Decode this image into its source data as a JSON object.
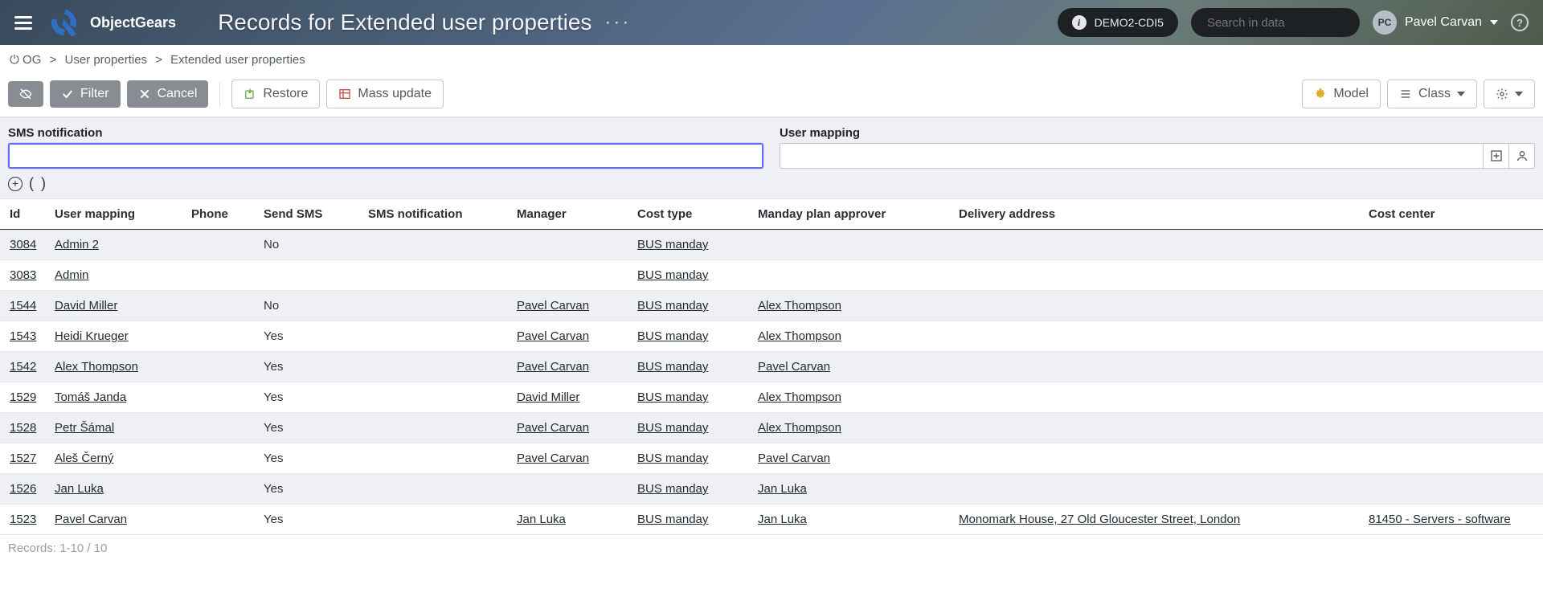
{
  "app": {
    "brand": "ObjectGears",
    "title": "Records for Extended user properties",
    "env_label": "DEMO2-CDI5",
    "search_placeholder": "Search in data",
    "user_initials": "PC",
    "user_name": "Pavel Carvan"
  },
  "breadcrumb": {
    "root": "OG",
    "level1": "User properties",
    "level2": "Extended user properties"
  },
  "toolbar": {
    "filter_label": "Filter",
    "cancel_label": "Cancel",
    "restore_label": "Restore",
    "mass_update_label": "Mass update",
    "model_label": "Model",
    "class_label": "Class"
  },
  "filters": {
    "sms_label": "SMS notification",
    "usermapping_label": "User mapping"
  },
  "columns": {
    "id": "Id",
    "user_mapping": "User mapping",
    "phone": "Phone",
    "send_sms": "Send SMS",
    "sms_notification": "SMS notification",
    "manager": "Manager",
    "cost_type": "Cost type",
    "manday_approver": "Manday plan approver",
    "delivery_address": "Delivery address",
    "cost_center": "Cost center"
  },
  "rows": [
    {
      "id": "3084",
      "user_mapping": "Admin 2",
      "phone": "",
      "send_sms": "No",
      "sms_notification": "",
      "manager": "",
      "cost_type": "BUS manday",
      "manday_approver": "",
      "delivery_address": "",
      "cost_center": ""
    },
    {
      "id": "3083",
      "user_mapping": "Admin",
      "phone": "",
      "send_sms": "",
      "sms_notification": "",
      "manager": "",
      "cost_type": "BUS manday",
      "manday_approver": "",
      "delivery_address": "",
      "cost_center": ""
    },
    {
      "id": "1544",
      "user_mapping": "David Miller",
      "phone": "",
      "send_sms": "No",
      "sms_notification": "",
      "manager": "Pavel Carvan",
      "cost_type": "BUS manday",
      "manday_approver": "Alex Thompson",
      "delivery_address": "",
      "cost_center": ""
    },
    {
      "id": "1543",
      "user_mapping": "Heidi Krueger",
      "phone": "",
      "send_sms": "Yes",
      "sms_notification": "",
      "manager": "Pavel Carvan",
      "cost_type": "BUS manday",
      "manday_approver": "Alex Thompson",
      "delivery_address": "",
      "cost_center": ""
    },
    {
      "id": "1542",
      "user_mapping": "Alex Thompson",
      "phone": "",
      "send_sms": "Yes",
      "sms_notification": "",
      "manager": "Pavel Carvan",
      "cost_type": "BUS manday",
      "manday_approver": "Pavel Carvan",
      "delivery_address": "",
      "cost_center": ""
    },
    {
      "id": "1529",
      "user_mapping": "Tomáš Janda",
      "phone": "",
      "send_sms": "Yes",
      "sms_notification": "",
      "manager": "David Miller",
      "cost_type": "BUS manday",
      "manday_approver": "Alex Thompson",
      "delivery_address": "",
      "cost_center": ""
    },
    {
      "id": "1528",
      "user_mapping": "Petr Šámal",
      "phone": "",
      "send_sms": "Yes",
      "sms_notification": "",
      "manager": "Pavel Carvan",
      "cost_type": "BUS manday",
      "manday_approver": "Alex Thompson",
      "delivery_address": "",
      "cost_center": ""
    },
    {
      "id": "1527",
      "user_mapping": "Aleš Černý",
      "phone": "",
      "send_sms": "Yes",
      "sms_notification": "",
      "manager": "Pavel Carvan",
      "cost_type": "BUS manday",
      "manday_approver": "Pavel Carvan",
      "delivery_address": "",
      "cost_center": ""
    },
    {
      "id": "1526",
      "user_mapping": "Jan Luka",
      "phone": "",
      "send_sms": "Yes",
      "sms_notification": "",
      "manager": "",
      "cost_type": "BUS manday",
      "manday_approver": "Jan Luka",
      "delivery_address": "",
      "cost_center": ""
    },
    {
      "id": "1523",
      "user_mapping": "Pavel Carvan",
      "phone": "",
      "send_sms": "Yes",
      "sms_notification": "",
      "manager": "Jan Luka",
      "cost_type": "BUS manday",
      "manday_approver": "Jan Luka",
      "delivery_address": "Monomark House, 27 Old Gloucester Street, London",
      "cost_center": "81450 - Servers - software"
    }
  ],
  "footer": {
    "records_label": "Records: 1-10 / 10"
  }
}
